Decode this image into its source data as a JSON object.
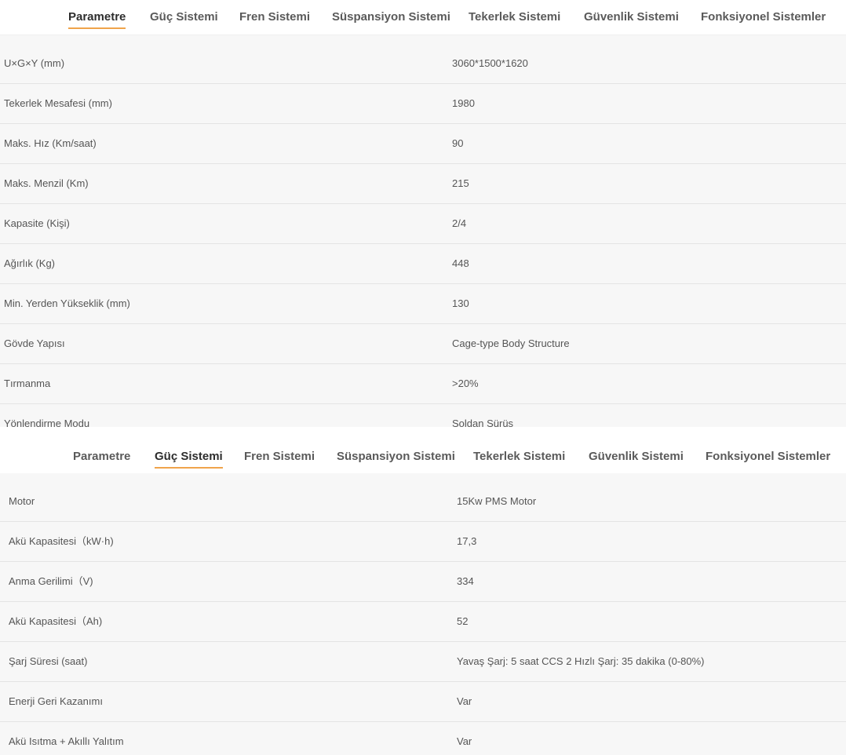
{
  "section1": {
    "tabs": [
      {
        "label": "Parametre"
      },
      {
        "label": "Güç Sistemi"
      },
      {
        "label": "Fren Sistemi"
      },
      {
        "label": "Süspansiyon Sistemi"
      },
      {
        "label": "Tekerlek Sistemi"
      },
      {
        "label": "Güvenlik Sistemi"
      },
      {
        "label": "Fonksiyonel Sistemler"
      }
    ],
    "active_tab": "Parametre",
    "rows": [
      {
        "label": "U×G×Y (mm)",
        "value": "3060*1500*1620"
      },
      {
        "label": "Tekerlek Mesafesi (mm)",
        "value": "1980"
      },
      {
        "label": "Maks. Hız (Km/saat)",
        "value": "90"
      },
      {
        "label": "Maks. Menzil (Km)",
        "value": "215"
      },
      {
        "label": "Kapasite (Kişi)",
        "value": "2/4"
      },
      {
        "label": "Ağırlık (Kg)",
        "value": "448"
      },
      {
        "label": "Min. Yerden Yükseklik (mm)",
        "value": "130"
      },
      {
        "label": "Gövde Yapısı",
        "value": "Cage-type Body Structure"
      },
      {
        "label": "Tırmanma",
        "value": ">20%"
      },
      {
        "label": "Yönlendirme Modu",
        "value": "Soldan Sürüş"
      }
    ]
  },
  "section2": {
    "tabs": [
      {
        "label": "Parametre"
      },
      {
        "label": "Güç Sistemi"
      },
      {
        "label": "Fren Sistemi"
      },
      {
        "label": "Süspansiyon Sistemi"
      },
      {
        "label": "Tekerlek Sistemi"
      },
      {
        "label": "Güvenlik Sistemi"
      },
      {
        "label": "Fonksiyonel Sistemler"
      }
    ],
    "active_tab": "Güç Sistemi",
    "rows": [
      {
        "label": "Motor",
        "value": "15Kw PMS Motor"
      },
      {
        "label": "Akü Kapasitesi（kW·h)",
        "value": "17,3"
      },
      {
        "label": "Anma Gerilimi（V)",
        "value": "334"
      },
      {
        "label": "Akü Kapasitesi（Ah)",
        "value": "52"
      },
      {
        "label": "Şarj Süresi (saat)",
        "value": "Yavaş Şarj: 5 saat CCS 2 Hızlı Şarj: 35 dakika (0-80%)"
      },
      {
        "label": "Enerji Geri Kazanımı",
        "value": "Var"
      },
      {
        "label": "Akü Isıtma + Akıllı Yalıtım",
        "value": "Var"
      }
    ]
  }
}
